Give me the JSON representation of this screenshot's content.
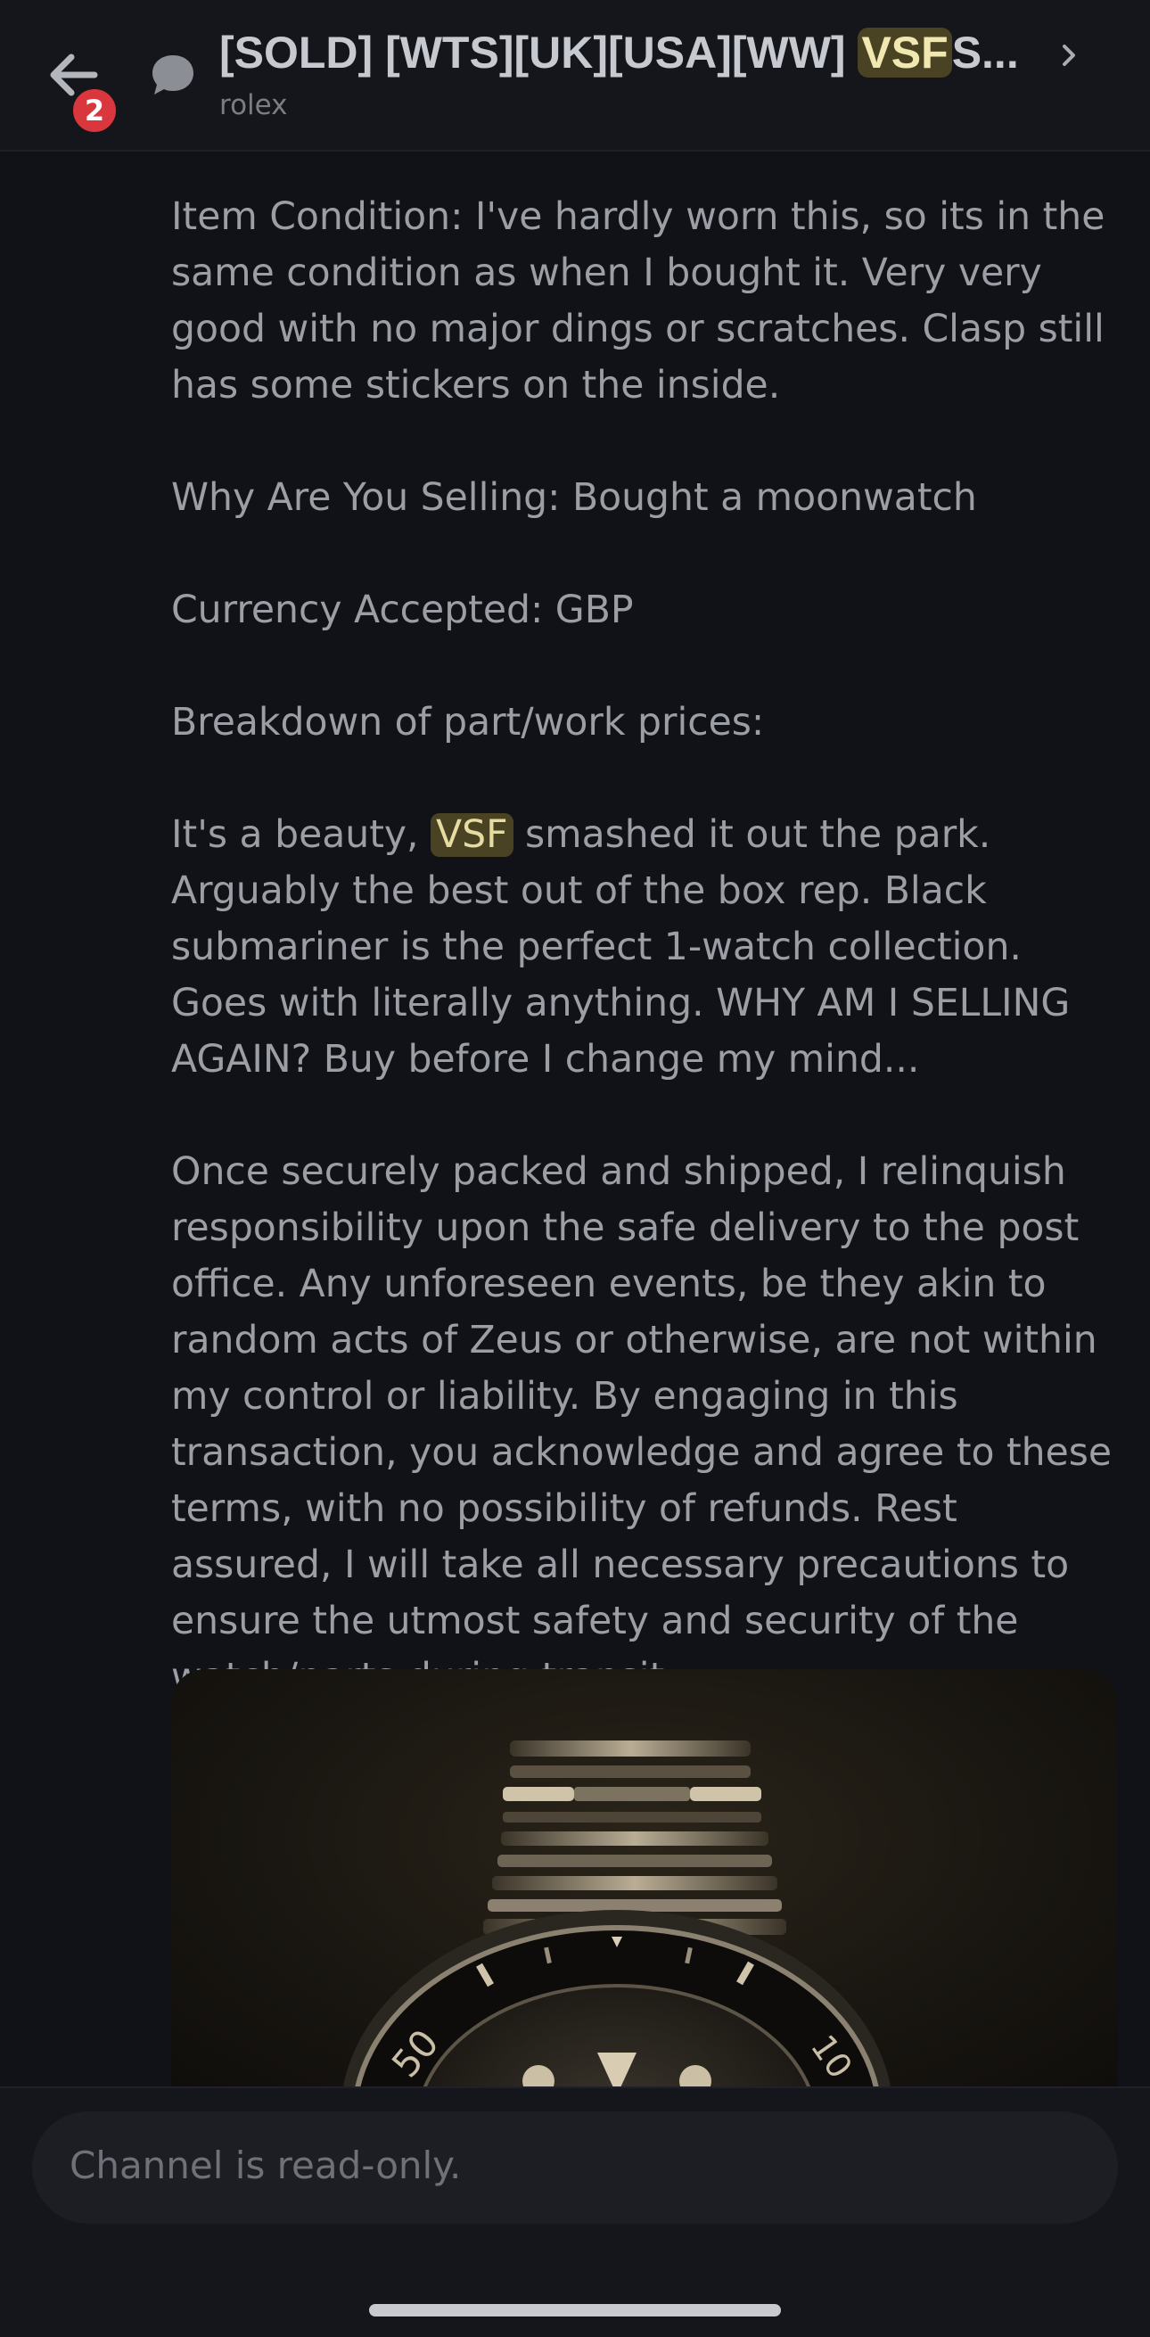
{
  "header": {
    "title_prefix": "[SOLD] [WTS][UK][USA][WW] ",
    "title_highlight": "VSF",
    "title_suffix": "S...",
    "subtitle": "rolex",
    "unread_count": "2",
    "icons": {
      "back": "arrow-left-icon",
      "thread": "chat-bubble-icon",
      "more": "chevron-right-icon"
    }
  },
  "message": {
    "p1": "Item Condition: I've hardly worn this, so its in the same condition as when I bought it. Very very good with no major dings or scratches. Clasp still has some stickers on the inside.",
    "p2": "Why Are You Selling: Bought a moonwatch",
    "p3": "Currency Accepted: GBP",
    "p4": "Breakdown of part/work prices:",
    "p5_before": "It's a beauty, ",
    "p5_highlight": "VSF",
    "p5_after": " smashed it out the park. Arguably the best out of the box rep. Black submariner is the perfect 1-watch collection. Goes with literally anything. WHY AM I SELLING AGAIN? Buy before I change my mind...",
    "p6": "Once securely packed and shipped, I relinquish responsibility upon the safe delivery to the post office. Any unforeseen events, be they akin to random acts of Zeus or otherwise, are not within my control or liability. By engaging in this transaction, you acknowledge and agree to these terms, with no possibility of refunds. Rest assured, I will take all necessary precautions to ensure the utmost safety and security of the watch/parts during transit."
  },
  "image": {
    "bezel_label": "50",
    "bezel_label_right": "10"
  },
  "composer": {
    "readonly_text": "Channel is read-only."
  },
  "colors": {
    "background": "#111217",
    "highlight": "#4a4323",
    "badge": "#d9363e"
  }
}
